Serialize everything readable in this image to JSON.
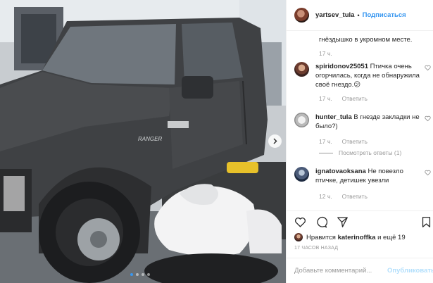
{
  "photo": {
    "alt_icon": "pickup-truck-photo",
    "badge_text": "RANGER",
    "dots": 4,
    "active_dot": 0
  },
  "header": {
    "username": "yartsev_tula",
    "separator": "•",
    "follow_label": "Подписаться"
  },
  "comments": {
    "tail_text": "гнёздышко в укромном месте.",
    "tail_time": "17 ч.",
    "items": [
      {
        "user": "spiridonov25051",
        "text": "Птичка очень огорчилась, когда не обнаружила своё гнездо.😕",
        "time": "17 ч.",
        "reply": "Ответить"
      },
      {
        "user": "hunter_tula",
        "text": "В гнезде закладки не было?)",
        "time": "17 ч.",
        "reply": "Ответить",
        "view_replies": "Посмотреть ответы (1)"
      },
      {
        "user": "ignatovaoksana",
        "text": "Не повезло птичке, детишек увезли",
        "time": "12 ч.",
        "reply": "Ответить"
      }
    ]
  },
  "actions": {
    "icons": [
      "heart-icon",
      "comment-icon",
      "share-icon",
      "bookmark-icon"
    ]
  },
  "likes": {
    "prefix": "Нравится",
    "user": "katerinoffka",
    "suffix": "и ещё 19"
  },
  "timestamp": "17 ЧАСОВ НАЗАД",
  "add_comment": {
    "placeholder": "Добавьте комментарий...",
    "publish_label": "Опубликовать"
  },
  "colors": {
    "link": "#3897f0",
    "publish_disabled": "#b2dffc",
    "muted": "#999999"
  }
}
